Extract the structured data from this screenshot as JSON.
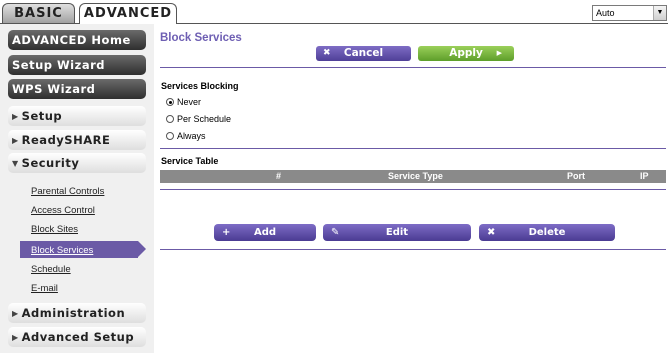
{
  "tabs": {
    "basic": "BASIC",
    "advanced": "ADVANCED"
  },
  "language_select": {
    "value": "Auto"
  },
  "sidebar": {
    "advanced_home": "ADVANCED Home",
    "setup_wizard": "Setup Wizard",
    "wps_wizard": "WPS Wizard",
    "setup": "Setup",
    "readyshare": "ReadySHARE",
    "security": "Security",
    "security_items": [
      "Parental Controls",
      "Access Control",
      "Block Sites",
      "Block Services",
      "Schedule",
      "E-mail"
    ],
    "administration": "Administration",
    "advanced_setup": "Advanced Setup"
  },
  "page": {
    "title": "Block Services",
    "cancel_label": "Cancel",
    "apply_label": "Apply",
    "blocking_heading": "Services Blocking",
    "options": [
      "Never",
      "Per Schedule",
      "Always"
    ],
    "selected_option": "Never",
    "table_heading": "Service Table",
    "table_columns": [
      "#",
      "Service Type",
      "Port",
      "IP"
    ],
    "add_label": "Add",
    "edit_label": "Edit",
    "delete_label": "Delete"
  },
  "colors": {
    "accent": "#6b5aa6",
    "apply_green": "#7cbb3f",
    "table_header": "#8a8a8a"
  }
}
